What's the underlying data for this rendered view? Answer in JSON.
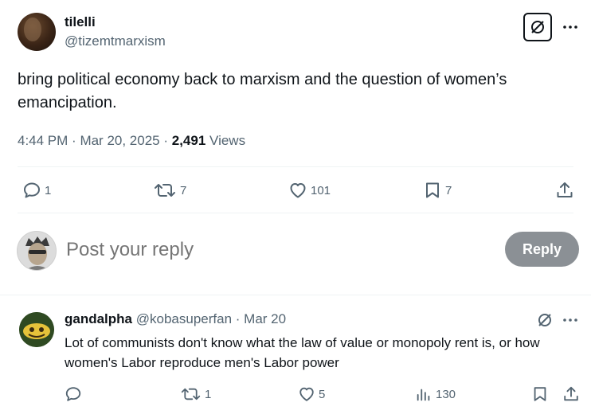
{
  "tweet": {
    "author_name": "tilelli",
    "author_handle": "@tizemtmarxism",
    "text": "bring political economy back to marxism and the question of women’s emancipation.",
    "time": "4:44 PM",
    "date": "Mar 20, 2025",
    "views_count": "2,491",
    "views_label": "Views",
    "replies": "1",
    "reposts": "7",
    "likes": "101",
    "bookmarks": "7"
  },
  "composer": {
    "placeholder": "Post your reply",
    "reply_button": "Reply"
  },
  "reply": {
    "author_name": "gandalpha",
    "author_handle": "@kobasuperfan",
    "date": "Mar 20",
    "text": "Lot of communists don't know what the law of value or monopoly rent is, or how women's Labor reproduce men's Labor power",
    "reposts": "1",
    "likes": "5",
    "views": "130"
  },
  "icons": {
    "grok": "grok-icon",
    "more": "more-icon",
    "reply": "reply-icon",
    "repost": "repost-icon",
    "like": "heart-icon",
    "bookmark": "bookmark-icon",
    "share": "share-icon",
    "views": "views-icon"
  },
  "colors": {
    "text": "#0f1419",
    "muted": "#536471",
    "reply_button_bg": "#8b9095",
    "divider": "#eff3f4"
  }
}
